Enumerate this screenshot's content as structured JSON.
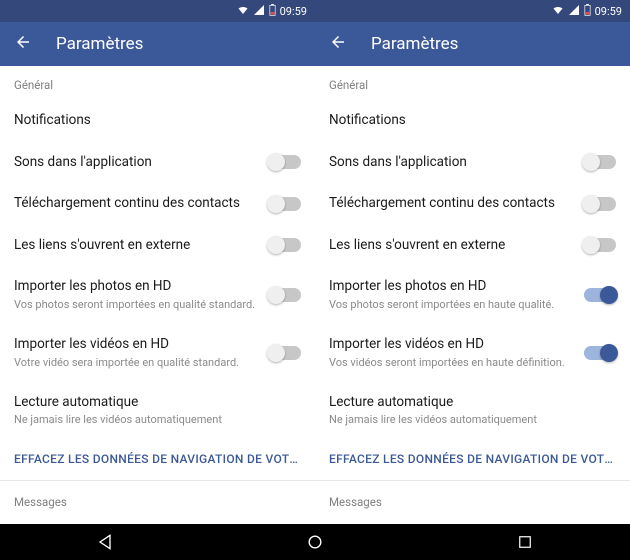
{
  "status": {
    "time": "09:59"
  },
  "appbar": {
    "title": "Paramètres"
  },
  "section_general": "Général",
  "section_messages": "Messages",
  "clear_link": "EFFACEZ LES DONNÉES DE NAVIGATION DE VOTRE TÉLÉ..",
  "left": {
    "notifications": "Notifications",
    "sounds": "Sons dans l'application",
    "contacts": "Téléchargement continu des contacts",
    "links": "Les liens s'ouvrent en externe",
    "photos_title": "Importer les photos en HD",
    "photos_sub": "Vos photos seront importées en qualité standard.",
    "videos_title": "Importer les vidéos en HD",
    "videos_sub": "Votre vidéo sera importée en qualité standard.",
    "autoplay_title": "Lecture automatique",
    "autoplay_sub": "Ne jamais lire les vidéos automatiquement",
    "toggles": {
      "sounds": false,
      "contacts": false,
      "links": false,
      "photos": false,
      "videos": false
    }
  },
  "right": {
    "notifications": "Notifications",
    "sounds": "Sons dans l'application",
    "contacts": "Téléchargement continu des contacts",
    "links": "Les liens s'ouvrent en externe",
    "photos_title": "Importer les photos en HD",
    "photos_sub": "Vos photos seront importées en haute qualité.",
    "videos_title": "Importer les vidéos en HD",
    "videos_sub": "Vos vidéos seront importées en haute définition.",
    "autoplay_title": "Lecture automatique",
    "autoplay_sub": "Ne jamais lire les vidéos automatiquement",
    "toggles": {
      "sounds": false,
      "contacts": false,
      "links": false,
      "photos": true,
      "videos": true
    }
  }
}
